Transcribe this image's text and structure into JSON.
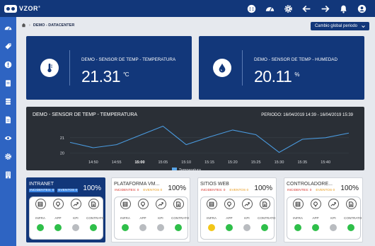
{
  "app": {
    "brand": "VZOR",
    "trademark": "®"
  },
  "topbar": {
    "icons": [
      "face-icon",
      "dashboard-gauge-icon",
      "gear-icon",
      "back-arrow-icon",
      "forward-arrow-icon",
      "bell-icon",
      "user-icon"
    ]
  },
  "sidebar": {
    "icons": [
      "speedometer-icon",
      "tag-icon",
      "alert-icon",
      "clipboard-icon",
      "database-icon",
      "file-icon",
      "eye-icon",
      "gear-icon",
      "building-icon"
    ]
  },
  "breadcrumb": {
    "current": "DEMO - DATACENTER"
  },
  "period_button": {
    "label": "Cambio global periodo",
    "icon": "chevron-down-icon"
  },
  "kpis": [
    {
      "title": "DEMO - SENSOR DE TEMP - TEMPERATURA",
      "value": "21.31",
      "unit": "°C",
      "icon": "thermometer-icon"
    },
    {
      "title": "DEMO - SENSOR DE TEMP - HUMEDAD",
      "value": "20.11",
      "unit": "%",
      "icon": "water-drop-icon"
    }
  ],
  "chart_panel": {
    "title": "DEMO - SENSOR DE TEMP - TEMPERATURA",
    "period": "PERIODO: 16/04/2019 14:39 - 16/04/2019 15:39"
  },
  "chart_data": {
    "type": "line",
    "title": "DEMO - SENSOR DE TEMP - TEMPERATURA",
    "x": [
      "14:46",
      "14:50",
      "14:55",
      "15:00",
      "15:05",
      "15:10",
      "15:15",
      "15:20",
      "15:25",
      "15:30",
      "15:35",
      "15:40",
      "15:42"
    ],
    "x_ticks": [
      "14:50",
      "14:55",
      "15:00",
      "15:05",
      "15:10",
      "15:15",
      "15:20",
      "15:25",
      "15:30",
      "15:35",
      "15:40"
    ],
    "bold_tick": "15:00",
    "series": [
      {
        "name": "Temperatura",
        "values": [
          20.7,
          20.35,
          20.55,
          21.15,
          21.75,
          20.55,
          21.05,
          21.5,
          21.2,
          20.05,
          20.9,
          21.0,
          21.3
        ]
      }
    ],
    "y_ticks": [
      20,
      21
    ],
    "ylim": [
      19.8,
      22.0
    ],
    "legend": "bottom-center",
    "grid": true,
    "colors": {
      "line": "#4a9be0",
      "legend": "#5aa6e8"
    }
  },
  "cards": [
    {
      "name": "INTRANET",
      "pct": "100%",
      "incidents": "INCIDENTES: 0",
      "events": "EVENTOS 0",
      "selected": true,
      "modules": [
        {
          "label": "INFRA",
          "icon": "server-icon",
          "status": "green"
        },
        {
          "label": "APP",
          "icon": "bulb-icon",
          "status": "green"
        },
        {
          "label": "KPI",
          "icon": "trend-icon",
          "status": "gray"
        },
        {
          "label": "CONTRATO",
          "icon": "document-icon",
          "status": "green"
        }
      ]
    },
    {
      "name": "PLATAFORMA VM...",
      "pct": "100%",
      "incidents": "INCIDENTES: 0",
      "events": "EVENTOS 0",
      "selected": false,
      "modules": [
        {
          "label": "INFRA",
          "icon": "server-icon",
          "status": "green"
        },
        {
          "label": "APP",
          "icon": "bulb-icon",
          "status": "gray"
        },
        {
          "label": "KPI",
          "icon": "trend-icon",
          "status": "gray"
        },
        {
          "label": "CONTRATO",
          "icon": "document-icon",
          "status": "green"
        }
      ]
    },
    {
      "name": "SITIOS WEB",
      "pct": "100%",
      "incidents": "INCIDENTES: 0",
      "events": "EVENTOS 0",
      "selected": false,
      "modules": [
        {
          "label": "INFRA",
          "icon": "server-icon",
          "status": "yellow"
        },
        {
          "label": "APP",
          "icon": "bulb-icon",
          "status": "green"
        },
        {
          "label": "KPI",
          "icon": "trend-icon",
          "status": "gray"
        },
        {
          "label": "CONTRATO",
          "icon": "document-icon",
          "status": "green"
        }
      ]
    },
    {
      "name": "CONTROLADORE...",
      "pct": "100%",
      "incidents": "INCIDENTES: 0",
      "events": "EVENTOS 0",
      "selected": false,
      "modules": [
        {
          "label": "INFRA",
          "icon": "server-icon",
          "status": "green"
        },
        {
          "label": "APP",
          "icon": "bulb-icon",
          "status": "green"
        },
        {
          "label": "KPI",
          "icon": "trend-icon",
          "status": "gray"
        },
        {
          "label": "CONTRATO",
          "icon": "document-icon",
          "status": "green"
        }
      ]
    }
  ],
  "status_colors": {
    "green": "#2fbf4a",
    "gray": "#b9bcc0",
    "yellow": "#f2c618",
    "red": "#d9342b"
  }
}
